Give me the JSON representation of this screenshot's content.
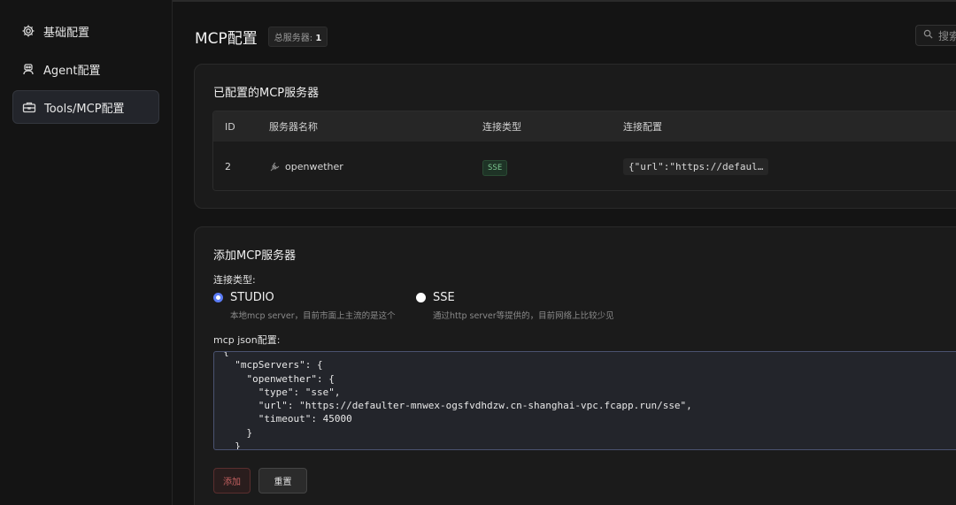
{
  "sidebar": {
    "items": [
      {
        "label": "基础配置",
        "icon": "gear-icon"
      },
      {
        "label": "Agent配置",
        "icon": "robot-icon"
      },
      {
        "label": "Tools/MCP配置",
        "icon": "toolbox-icon",
        "active": true
      }
    ]
  },
  "header": {
    "title": "MCP配置",
    "badge_label": "总服务器: ",
    "badge_count": "1",
    "search_placeholder": "搜索"
  },
  "configured": {
    "title": "已配置的MCP服务器",
    "columns": [
      "ID",
      "服务器名称",
      "连接类型",
      "连接配置"
    ],
    "rows": [
      {
        "id": "2",
        "name": "openwether",
        "type": "SSE",
        "config": "{\"url\":\"https://defaul…"
      }
    ]
  },
  "add_form": {
    "title": "添加MCP服务器",
    "conn_type_label": "连接类型:",
    "options": [
      {
        "label": "STUDIO",
        "desc": "本地mcp server，目前市面上主流的是这个",
        "checked": true
      },
      {
        "label": "SSE",
        "desc": "通过http server等提供的，目前网络上比较少见",
        "checked": false
      }
    ],
    "json_label": "mcp json配置:",
    "json_value": "{\n  \"mcpServers\": {\n    \"openwether\": {\n      \"type\": \"sse\",\n      \"url\": \"https://defaulter-mnwex-ogsfvdhdzw.cn-shanghai-vpc.fcapp.run/sse\",\n      \"timeout\": 45000\n    }\n  }",
    "add_button": "添加",
    "reset_button": "重置"
  },
  "colors": {
    "accent": "#5b7cf6",
    "sse_tag_text": "#7cc690",
    "danger_text": "#c46060"
  }
}
